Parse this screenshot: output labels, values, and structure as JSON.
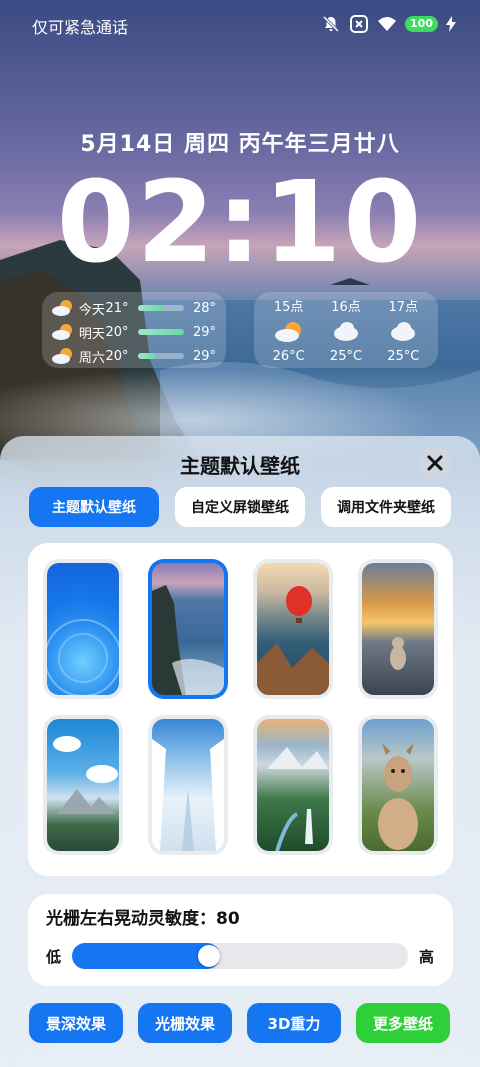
{
  "status_bar": {
    "left_text": "仅可紧急通话",
    "battery": "100",
    "icons": [
      "bell-muted-icon",
      "close-box-icon",
      "wifi-icon",
      "battery-icon",
      "charging-icon"
    ]
  },
  "lockscreen": {
    "date": "5月14日 周四 丙午年三月廿八",
    "time": "02:10"
  },
  "weather": {
    "daily": [
      {
        "day": "今天",
        "low": "21°",
        "high": "28°",
        "bar_fill": 0.55,
        "icon": "partly-cloudy-icon"
      },
      {
        "day": "明天",
        "low": "20°",
        "high": "29°",
        "bar_fill": 1.0,
        "icon": "partly-cloudy-icon"
      },
      {
        "day": "周六",
        "low": "20°",
        "high": "29°",
        "bar_fill": 0.4,
        "icon": "partly-cloudy-icon"
      }
    ],
    "hourly": [
      {
        "hour": "15点",
        "temp": "26°C",
        "icon": "partly-cloudy-icon"
      },
      {
        "hour": "16点",
        "temp": "25°C",
        "icon": "cloudy-icon"
      },
      {
        "hour": "17点",
        "temp": "25°C",
        "icon": "cloudy-icon"
      }
    ]
  },
  "sheet": {
    "title": "主题默认壁纸",
    "tabs": [
      {
        "label": "主题默认壁纸",
        "active": true
      },
      {
        "label": "自定义屏锁壁纸",
        "active": false
      },
      {
        "label": "调用文件夹壁纸",
        "active": false
      }
    ],
    "wallpapers": [
      {
        "name": "blue-abstract",
        "selected": false
      },
      {
        "name": "sea-cliff",
        "selected": true
      },
      {
        "name": "hot-air-balloon",
        "selected": false
      },
      {
        "name": "cat-sunset",
        "selected": false
      },
      {
        "name": "mountain-clouds",
        "selected": false
      },
      {
        "name": "snowy-forest",
        "selected": false
      },
      {
        "name": "valley-waterfall",
        "selected": false
      },
      {
        "name": "alpaca",
        "selected": false
      }
    ],
    "slider": {
      "title": "光栅左右晃动灵敏度：80",
      "low_label": "低",
      "high_label": "高",
      "value": 80,
      "max": 100
    },
    "actions": [
      {
        "label": "景深效果",
        "color": "#1676f2"
      },
      {
        "label": "光栅效果",
        "color": "#1676f2"
      },
      {
        "label": "3D重力",
        "color": "#1676f2"
      },
      {
        "label": "更多壁纸",
        "color": "#2fcf3a"
      }
    ]
  }
}
